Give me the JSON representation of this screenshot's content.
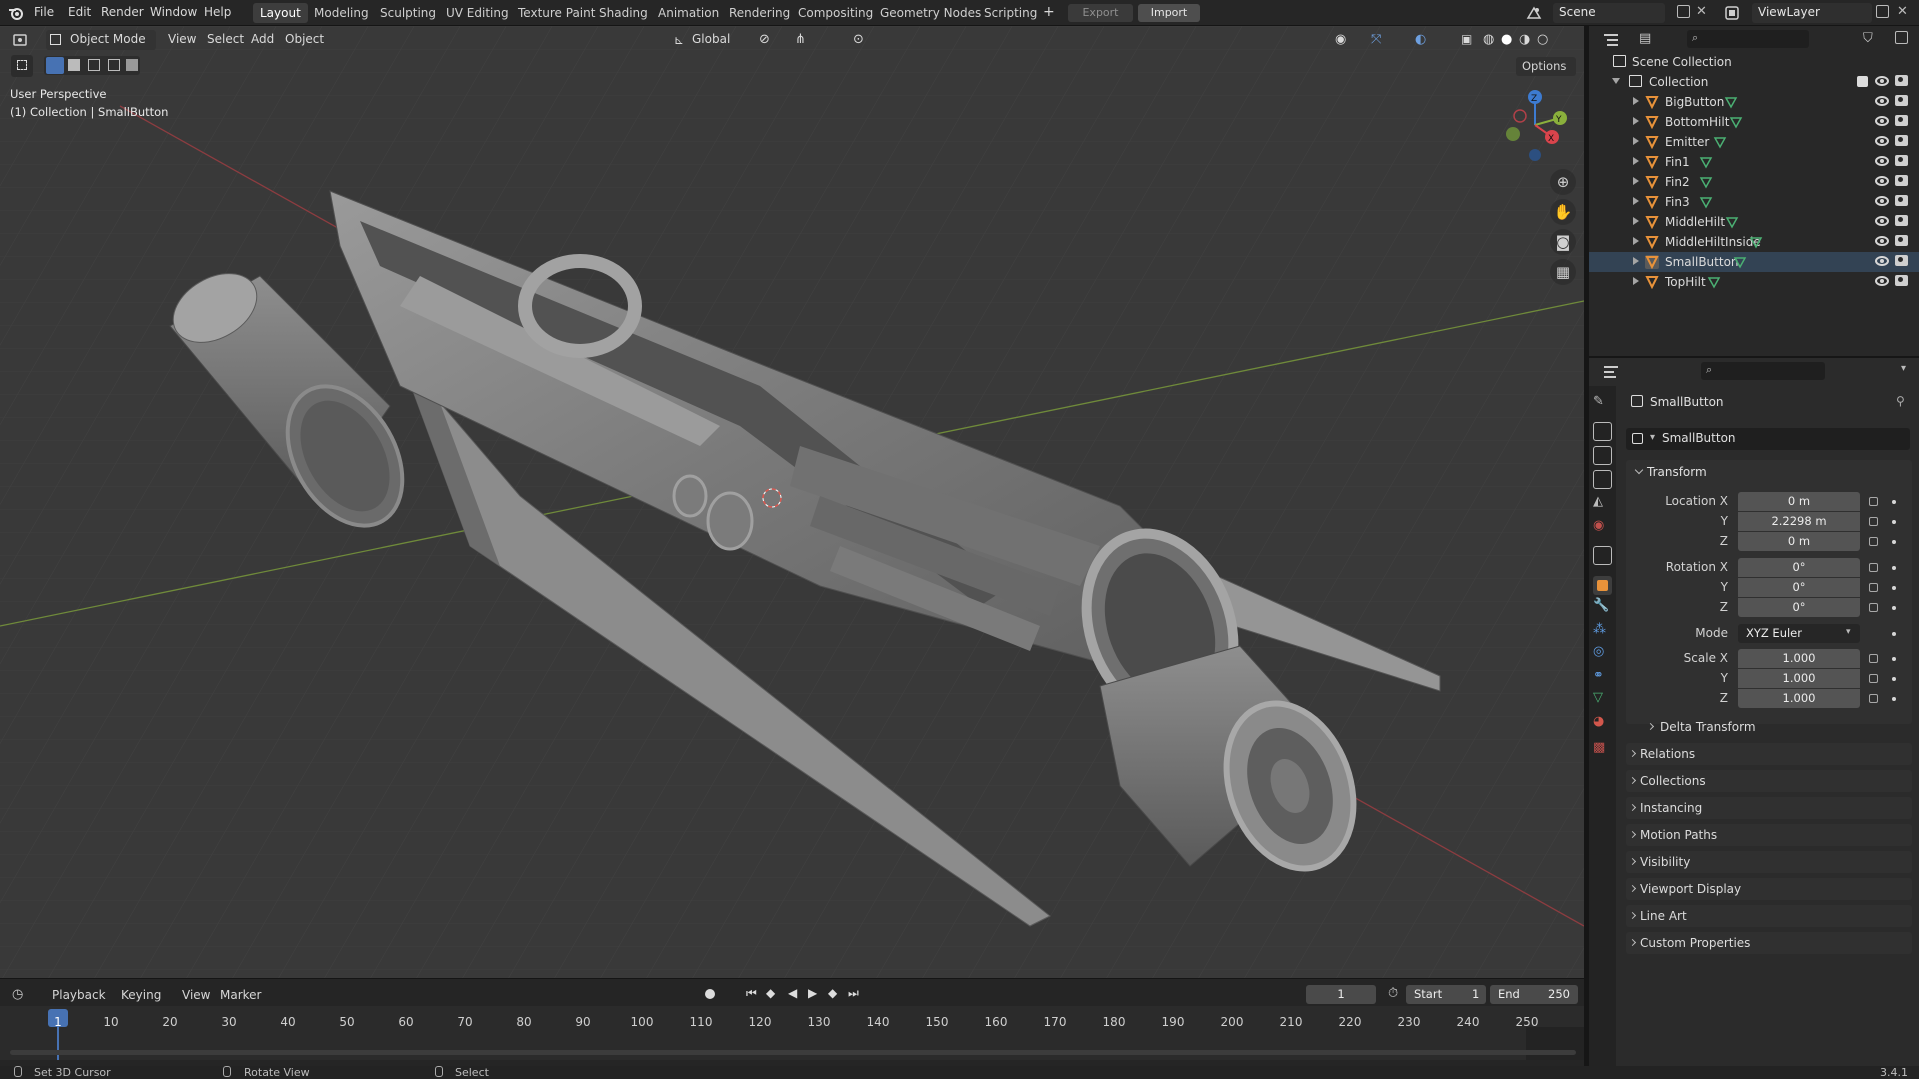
{
  "topbar": {
    "menus": [
      "File",
      "Edit",
      "Render",
      "Window",
      "Help"
    ],
    "workspaces": [
      "Layout",
      "Modeling",
      "Sculpting",
      "UV Editing",
      "Texture Paint",
      "Shading",
      "Animation",
      "Rendering",
      "Compositing",
      "Geometry Nodes",
      "Scripting"
    ],
    "active_workspace": "Layout",
    "add_workspace": "+",
    "export_label": "Export",
    "import_label": "Import",
    "scene_name": "Scene",
    "view_layer": "ViewLayer"
  },
  "viewport_header": {
    "mode": "Object Mode",
    "menus": [
      "View",
      "Select",
      "Add",
      "Object"
    ],
    "orientation": "Global",
    "options_label": "Options"
  },
  "viewport": {
    "perspective": "User Perspective",
    "context": "(1) Collection | SmallButton",
    "gizmo_axes": [
      "Z",
      "Y",
      "X"
    ]
  },
  "outliner": {
    "root": "Scene Collection",
    "collection": "Collection",
    "objects": [
      "BigButton",
      "BottomHilt",
      "Emitter",
      "Fin1",
      "Fin2",
      "Fin3",
      "MiddleHilt",
      "MiddleHiltInside",
      "SmallButton",
      "TopHilt"
    ],
    "selected": "SmallButton"
  },
  "properties": {
    "object_name": "SmallButton",
    "datablock": "SmallButton",
    "transform_header": "Transform",
    "location_label": "Location X",
    "location": [
      "0 m",
      "2.2298 m",
      "0 m"
    ],
    "rotation_label": "Rotation X",
    "rotation": [
      "0°",
      "0°",
      "0°"
    ],
    "y_label": "Y",
    "z_label": "Z",
    "mode_label": "Mode",
    "mode_value": "XYZ Euler",
    "scale_label": "Scale X",
    "scale": [
      "1.000",
      "1.000",
      "1.000"
    ],
    "delta_transform": "Delta Transform",
    "panels": [
      "Relations",
      "Collections",
      "Instancing",
      "Motion Paths",
      "Visibility",
      "Viewport Display",
      "Line Art",
      "Custom Properties"
    ]
  },
  "timeline": {
    "menus": [
      "Playback",
      "Keying",
      "View",
      "Marker"
    ],
    "current_frame": "1",
    "start_label": "Start",
    "start": "1",
    "end_label": "End",
    "end": "250",
    "ticks": [
      "1",
      "10",
      "20",
      "30",
      "40",
      "50",
      "60",
      "70",
      "80",
      "90",
      "100",
      "110",
      "120",
      "130",
      "140",
      "150",
      "160",
      "170",
      "180",
      "190",
      "200",
      "210",
      "220",
      "230",
      "240",
      "250"
    ]
  },
  "statusbar": {
    "items": [
      "Set 3D Cursor",
      "Rotate View",
      "Select"
    ],
    "version": "3.4.1"
  },
  "colors": {
    "accent": "#4772b3",
    "mesh_orange": "#e8923a",
    "x_axis": "#d9444c",
    "y_axis": "#8ab03c",
    "z_axis": "#3d7bd1"
  }
}
